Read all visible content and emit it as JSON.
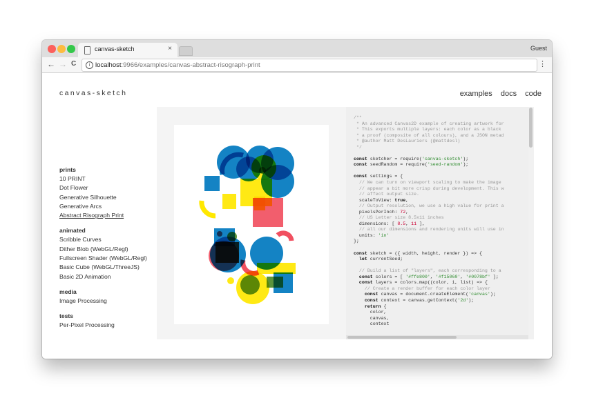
{
  "browser": {
    "tab_title": "canvas-sketch",
    "tab_close": "×",
    "profile": "Guest",
    "url_host": "localhost",
    "url_path": ":9966/examples/canvas-abstract-risograph-print",
    "back_glyph": "←",
    "forward_glyph": "→",
    "reload_glyph": "C",
    "menu_glyph": "⋮"
  },
  "site": {
    "logo": "canvas-sketch",
    "nav": [
      "examples",
      "docs",
      "code"
    ]
  },
  "sidebar": {
    "sections": [
      {
        "title": "prints",
        "items": [
          "10 PRINT",
          "Dot Flower",
          "Generative Silhouette",
          "Generative Arcs",
          "Abstract Risograph Print"
        ],
        "active": 4
      },
      {
        "title": "animated",
        "items": [
          "Scribble Curves",
          "Dither Blob (WebGL/Regl)",
          "Fullscreen Shader (WebGL/Regl)",
          "Basic Cube (WebGL/ThreeJS)",
          "Basic 2D Animation"
        ]
      },
      {
        "title": "media",
        "items": [
          "Image Processing"
        ]
      },
      {
        "title": "tests",
        "items": [
          "Per-Pixel Processing"
        ]
      }
    ]
  },
  "colors": {
    "yellow": "#ffe800",
    "red": "#f15060",
    "blue": "#0078bf"
  },
  "code_lines": [
    "/**",
    " * An advanced Canvas2D example of creating artwork for",
    " * This exports multiple layers: each color as a black",
    " * a proof (composite of all colours), and a JSON metad",
    " * @author Matt DesLauriers (@mattdesl)",
    " */",
    "",
    "const sketcher = require('canvas-sketch');",
    "const seedRandom = require('seed-random');",
    "",
    "const settings = {",
    "  // We can turn on viewport scaling to make the image",
    "  // appear a bit more crisp during development. This w",
    "  // affect output size.",
    "  scaleToView: true,",
    "  // Output resolution, we use a high value for print a",
    "  pixelsPerInch: 72,",
    "  // US Letter size 8.5x11 inches",
    "  dimensions: [ 8.5, 11 ],",
    "  // all our dimensions and rendering units will use in",
    "  units: 'in'",
    "};",
    "",
    "const sketch = ({ width, height, render }) => {",
    "  let currentSeed;",
    "",
    "  // Build a list of \"layers\", each corresponding to a",
    "  const colors = [ '#ffe800', '#f15060', '#0078bf' ];",
    "  const layers = colors.map((color, i, list) => {",
    "    // Create a render buffer for each color layer",
    "    const canvas = document.createElement('canvas');",
    "    const context = canvas.getContext('2d');",
    "    return {",
    "      color,",
    "      canvas,",
    "      context"
  ]
}
